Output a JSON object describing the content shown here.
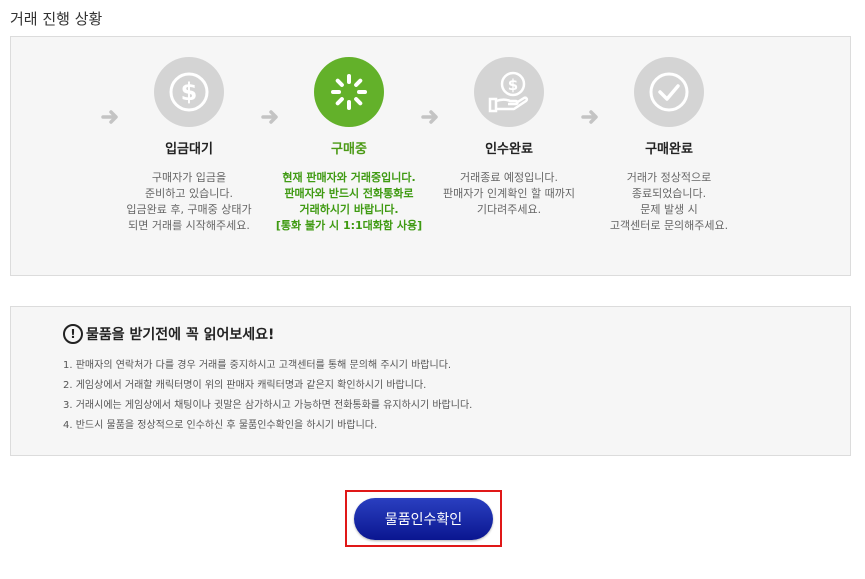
{
  "section_title": "거래 진행 상황",
  "steps": [
    {
      "title": "입금대기",
      "desc": "구매자가 입금을\n준비하고 있습니다.\n입금완료 후, 구매중 상태가\n되면 거래를 시작해주세요.",
      "icon": "dollar-icon"
    },
    {
      "title": "구매중",
      "desc": "현재 판매자와 거래중입니다.\n판매자와 반드시 전화통화로\n거래하시기 바랍니다.\n[통화 불가 시 1:1대화함 사용]",
      "icon": "loading-icon"
    },
    {
      "title": "인수완료",
      "desc": "거래종료 예정입니다.\n판매자가 인계확인 할 때까지\n기다려주세요.",
      "icon": "hand-coin-icon"
    },
    {
      "title": "구매완료",
      "desc": "거래가 정상적으로\n종료되었습니다.\n문제 발생 시\n고객센터로 문의해주세요.",
      "icon": "check-icon"
    }
  ],
  "notice": {
    "title": "물품을 받기전에 꼭 읽어보세요!",
    "items": [
      "1. 판매자의 연락처가 다를 경우 거래를 중지하시고 고객센터를 통해 문의해 주시기 바랍니다.",
      "2. 게임상에서 거래할 캐릭터명이 위의 판매자 캐릭터명과 같은지 확인하시기 바랍니다.",
      "3. 거래시에는 게임상에서 채팅이나 귓말은 삼가하시고 가능하면 전화통화를 유지하시기 바랍니다.",
      "4. 반드시 물품을 정상적으로 인수하신 후 물품인수확인을 하시기 바랍니다."
    ]
  },
  "confirm_label": "물품인수확인",
  "colors": {
    "active": "#63b12a",
    "inactive": "#d4d4d4",
    "button": "#0a1690",
    "highlight": "#e01818"
  }
}
